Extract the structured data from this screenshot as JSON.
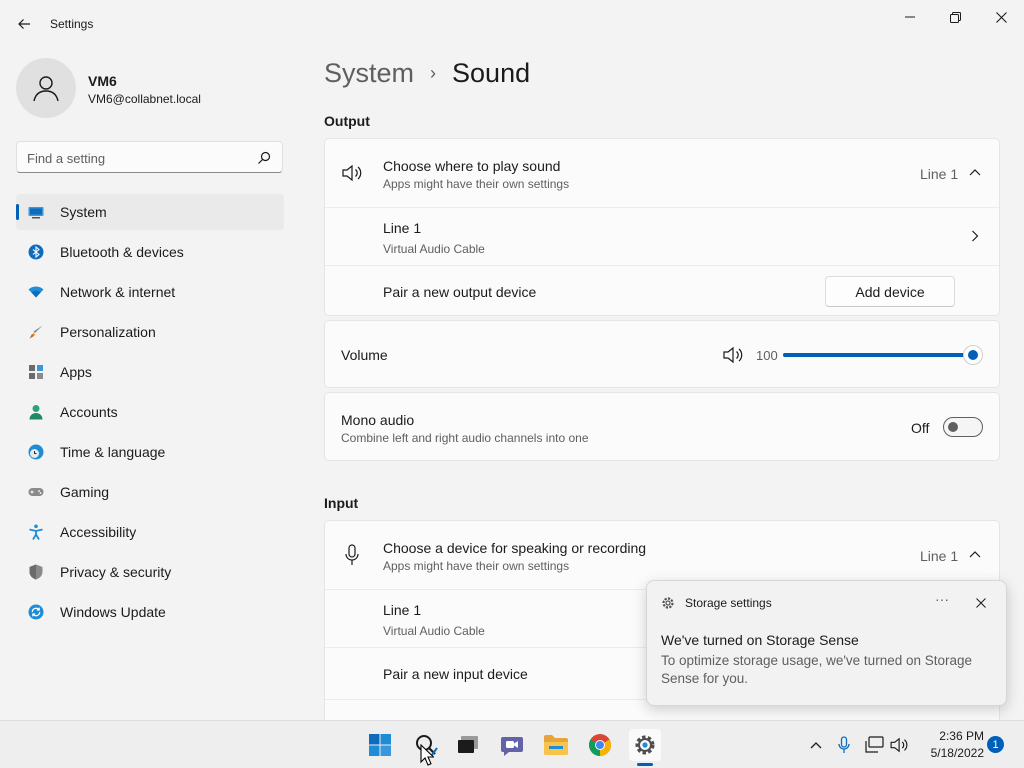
{
  "app": {
    "title": "Settings"
  },
  "user": {
    "name": "VM6",
    "email": "VM6@collabnet.local"
  },
  "search": {
    "placeholder": "Find a setting"
  },
  "sidebar": {
    "items": [
      {
        "label": "System",
        "icon": "system-icon",
        "selected": true
      },
      {
        "label": "Bluetooth & devices",
        "icon": "bluetooth-icon"
      },
      {
        "label": "Network & internet",
        "icon": "wifi-icon"
      },
      {
        "label": "Personalization",
        "icon": "brush-icon"
      },
      {
        "label": "Apps",
        "icon": "apps-icon"
      },
      {
        "label": "Accounts",
        "icon": "accounts-icon"
      },
      {
        "label": "Time & language",
        "icon": "clock-globe-icon"
      },
      {
        "label": "Gaming",
        "icon": "gamepad-icon"
      },
      {
        "label": "Accessibility",
        "icon": "accessibility-icon"
      },
      {
        "label": "Privacy & security",
        "icon": "shield-icon"
      },
      {
        "label": "Windows Update",
        "icon": "update-icon"
      }
    ]
  },
  "breadcrumb": {
    "parent": "System",
    "separator": "›",
    "current": "Sound"
  },
  "output": {
    "heading": "Output",
    "choose": {
      "title": "Choose where to play sound",
      "subtitle": "Apps might have their own settings",
      "value": "Line 1"
    },
    "device": {
      "name": "Line 1",
      "subtitle": "Virtual Audio Cable"
    },
    "pair": {
      "label": "Pair a new output device",
      "button": "Add device"
    }
  },
  "volume": {
    "label": "Volume",
    "value": "100",
    "level": 1.0
  },
  "mono": {
    "title": "Mono audio",
    "subtitle": "Combine left and right audio channels into one",
    "state": "Off"
  },
  "input": {
    "heading": "Input",
    "choose": {
      "title": "Choose a device for speaking or recording",
      "subtitle": "Apps might have their own settings",
      "value": "Line 1"
    },
    "device": {
      "name": "Line 1",
      "subtitle": "Virtual Audio Cable"
    },
    "pair": {
      "label": "Pair a new input device"
    }
  },
  "toast": {
    "app": "Storage settings",
    "more": "···",
    "title": "We've turned on Storage Sense",
    "body": "To optimize storage usage, we've turned on Storage Sense for you."
  },
  "taskbar": {
    "time": "2:36 PM",
    "date": "5/18/2022",
    "notifications": "1"
  },
  "colors": {
    "accent": "#005fb8",
    "background": "#f3f3f3",
    "card": "#fbfbfb"
  }
}
